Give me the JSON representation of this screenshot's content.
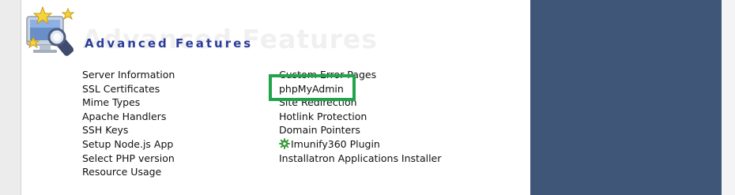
{
  "section": {
    "title": "Advanced Features",
    "ghost_title": "Advanced Features"
  },
  "columns": {
    "left": [
      "Server Information",
      "SSL Certificates",
      "Mime Types",
      "Apache Handlers",
      "SSH Keys",
      "Setup Node.js App",
      "Select PHP version",
      "Resource Usage"
    ],
    "right": [
      "Custom Error Pages",
      "phpMyAdmin",
      "Site Redirection",
      "Hotlink Protection",
      "Domain Pointers",
      "Imunify360 Plugin",
      "Installatron Applications Installer"
    ]
  },
  "icons": {
    "section": "advanced-features-icon",
    "imunify": "gear-icon"
  },
  "colors": {
    "title": "#2a3d9a",
    "side_panel": "#3f5678",
    "highlight": "#22a44c"
  }
}
